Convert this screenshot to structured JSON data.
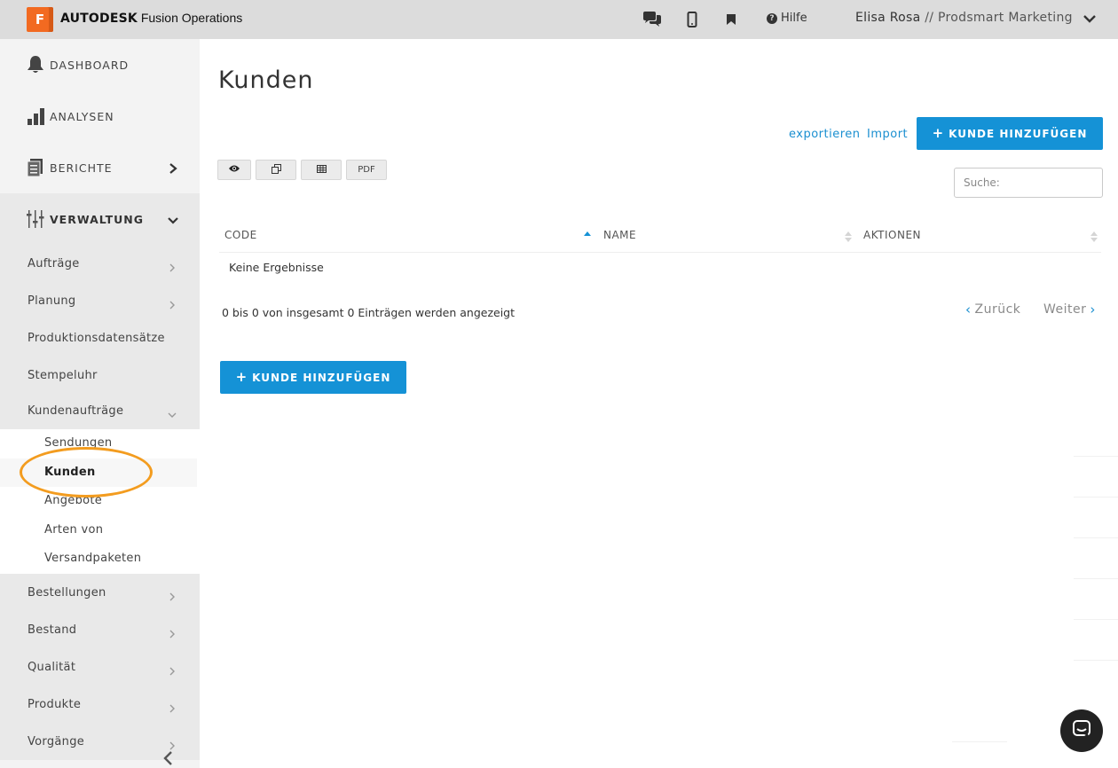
{
  "brand": {
    "logo_letter": "F",
    "name_bold": "AUTODESK",
    "name_rest": " Fusion Operations",
    "color": "#f26a21"
  },
  "topbar": {
    "icons": [
      "chat-icon",
      "mobile-icon",
      "bookmark-icon"
    ],
    "help_label": "Hilfe",
    "user_name": "Elisa Rosa",
    "user_org": " // Prodsmart Marketing"
  },
  "sidebar": {
    "main_items": [
      {
        "label": "DASHBOARD",
        "icon": "bell-icon"
      },
      {
        "label": "ANALYSEN",
        "icon": "bar-chart-icon"
      },
      {
        "label": "BERICHTE",
        "icon": "report-icon"
      },
      {
        "label": "VERWALTUNG",
        "icon": "sliders-icon"
      }
    ],
    "sub_items": [
      "Aufträge",
      "Planung",
      "Produktionsdatensätze",
      "Stempeluhr",
      "Kundenaufträge"
    ],
    "subsub_items": [
      "Sendungen",
      "Kunden",
      "Angebote",
      "Arten von",
      "Versandpaketen"
    ],
    "lower_items": [
      "Bestellungen",
      "Bestand",
      "Qualität",
      "Produkte",
      "Vorgänge"
    ],
    "active_item": "Kunden",
    "highlight_color": "#f39c1f"
  },
  "main": {
    "title": "Kunden",
    "export_link": "exportieren",
    "import_link": "Import",
    "add_button": "KUNDE HINZUFÜGEN",
    "add_button_color": "#1592d6",
    "tools": {
      "view_icon": "eye-icon",
      "copy_icon": "copy-icon",
      "csv_icon": "table-icon",
      "pdf_label": "PDF"
    },
    "search_placeholder": "Suche:",
    "columns": [
      "CODE",
      "NAME",
      "AKTIONEN"
    ],
    "empty_text": "Keine Ergebnisse",
    "info_text": "0 bis 0 von insgesamt 0 Einträgen werden angezeigt",
    "prev_label": "Zurück",
    "next_label": "Weiter",
    "add_button_bottom": "KUNDE HINZUFÜGEN"
  },
  "chat_widget": {
    "icon": "chat-bubble-icon"
  }
}
